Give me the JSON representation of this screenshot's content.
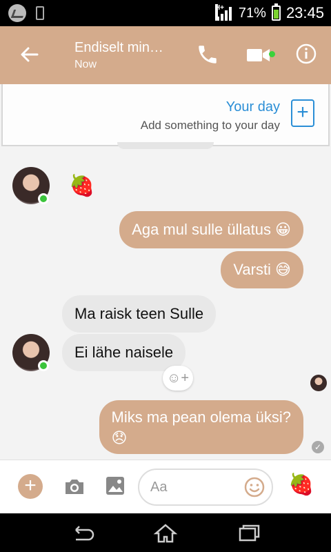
{
  "status_bar": {
    "network": "H+",
    "battery_percent": "71%",
    "time": "23:45"
  },
  "header": {
    "title": "Endiselt min…",
    "subtitle": "Now"
  },
  "your_day": {
    "title": "Your day",
    "subtitle": "Add something to your day",
    "add_label": "+"
  },
  "messages": [
    {
      "side": "in",
      "type": "sticker",
      "text": "🍓"
    },
    {
      "side": "out",
      "text": "Aga mul sulle üllatus 😀"
    },
    {
      "side": "out",
      "text": "Varsti 😅"
    },
    {
      "side": "in",
      "text": "Ma raisk teen Sulle"
    },
    {
      "side": "in",
      "text": "Ei lähe naisele"
    },
    {
      "side": "out",
      "text": "Miks ma pean olema üksi?",
      "emoji": "😞"
    }
  ],
  "reaction_button": "☺+",
  "composer": {
    "plus_label": "+",
    "placeholder": "Aa",
    "quick_reaction": "🍓"
  },
  "colors": {
    "accent": "#d4ab8c",
    "link_blue": "#2a8ed6",
    "online_green": "#3bc43b",
    "incoming_bubble": "#e8e8e8"
  }
}
